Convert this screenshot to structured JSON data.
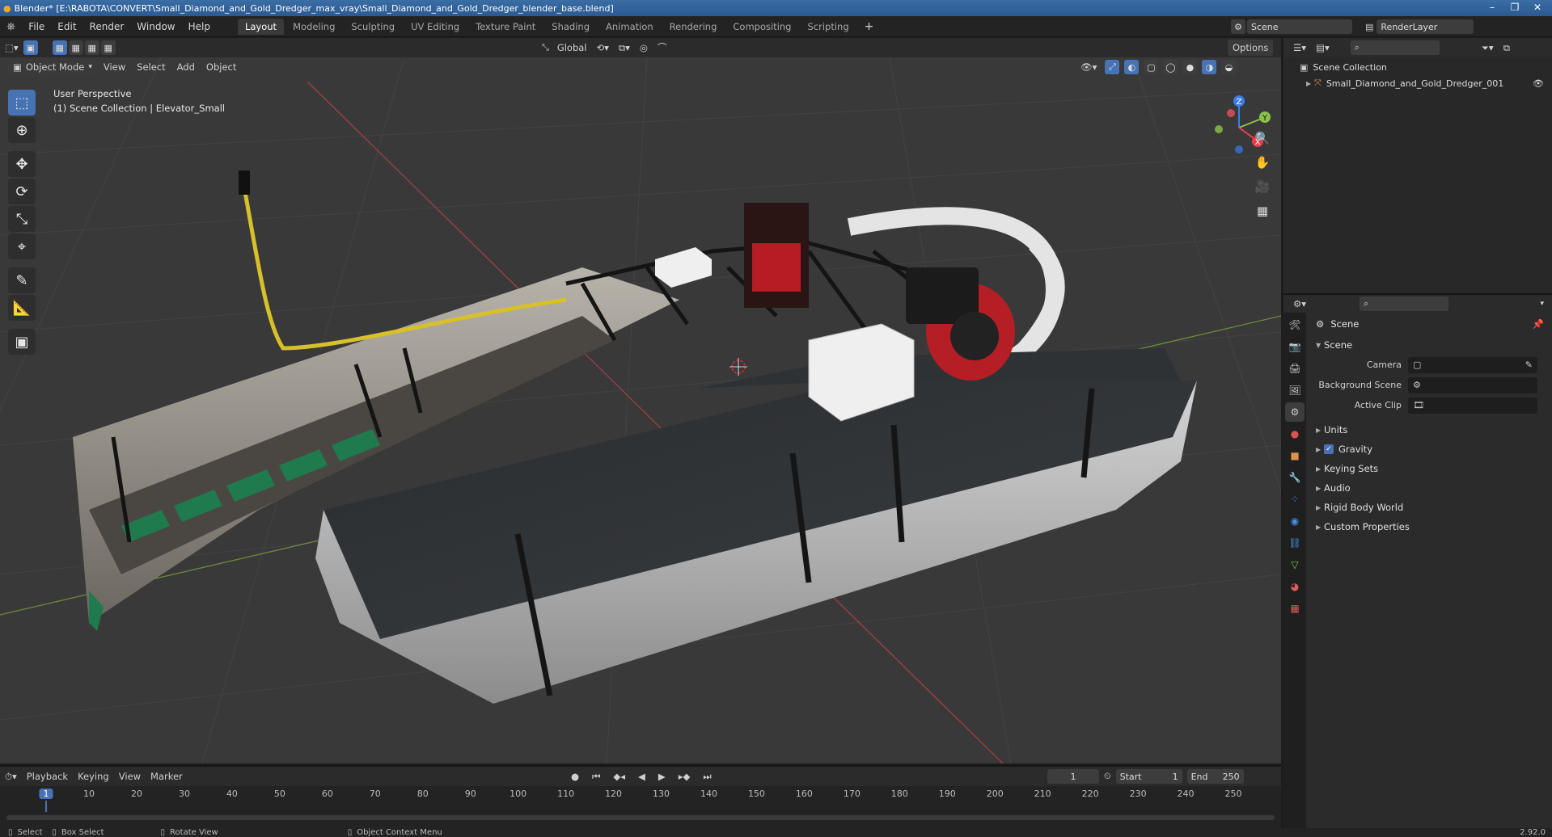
{
  "window": {
    "title": "Blender* [E:\\RABOTA\\CONVERT\\Small_Diamond_and_Gold_Dredger_max_vray\\Small_Diamond_and_Gold_Dredger_blender_base.blend]",
    "controls": [
      "–",
      "❐",
      "✕"
    ]
  },
  "menu": {
    "items": [
      "File",
      "Edit",
      "Render",
      "Window",
      "Help"
    ],
    "workspaces": [
      "Layout",
      "Modeling",
      "Sculpting",
      "UV Editing",
      "Texture Paint",
      "Shading",
      "Animation",
      "Rendering",
      "Compositing",
      "Scripting"
    ],
    "active_workspace": "Layout",
    "scene_name": "Scene",
    "view_layer": "RenderLayer"
  },
  "viewport_header": {
    "orientation": "Global",
    "options_label": "Options",
    "mode": "Object Mode",
    "menus": [
      "View",
      "Select",
      "Add",
      "Object"
    ]
  },
  "viewport": {
    "perspective_label": "User Perspective",
    "context_label": "(1) Scene Collection | Elevator_Small",
    "gizmo_axes": [
      "Z",
      "Y",
      "X"
    ]
  },
  "outliner": {
    "root": "Scene Collection",
    "objects": [
      "Small_Diamond_and_Gold_Dredger_001"
    ]
  },
  "properties": {
    "title": "Scene",
    "section": "Scene",
    "rows": [
      {
        "label": "Camera",
        "value": ""
      },
      {
        "label": "Background Scene",
        "value": ""
      },
      {
        "label": "Active Clip",
        "value": ""
      }
    ],
    "panels": [
      "Units",
      "Gravity",
      "Keying Sets",
      "Audio",
      "Rigid Body World",
      "Custom Properties"
    ],
    "gravity_checked": true
  },
  "timeline": {
    "menus": [
      "Playback",
      "Keying",
      "View",
      "Marker"
    ],
    "current_frame": "1",
    "start_label": "Start",
    "start": "1",
    "end_label": "End",
    "end": "250",
    "ticks": [
      "1",
      "10",
      "20",
      "30",
      "40",
      "50",
      "60",
      "70",
      "80",
      "90",
      "100",
      "110",
      "120",
      "130",
      "140",
      "150",
      "160",
      "170",
      "180",
      "190",
      "200",
      "210",
      "220",
      "230",
      "240",
      "250"
    ]
  },
  "statusbar": {
    "items": [
      "Select",
      "Box Select",
      "Rotate View",
      "Object Context Menu"
    ],
    "version": "2.92.0"
  },
  "colors": {
    "accent": "#4772b3",
    "x_axis": "#e83c4a",
    "y_axis": "#8bc34a",
    "z_axis": "#3d7ee6"
  }
}
